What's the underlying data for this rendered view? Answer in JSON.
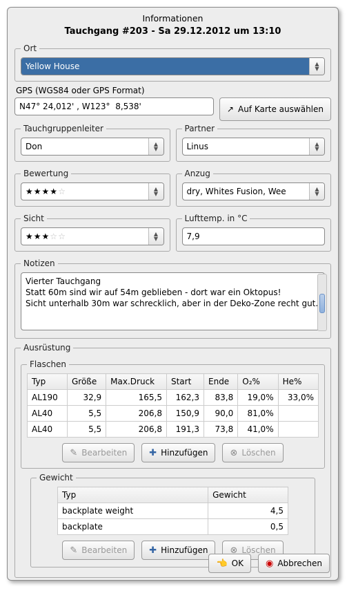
{
  "window": {
    "title": "Informationen",
    "subtitle": "Tauchgang #203 - Sa 29.12.2012 um 13:10"
  },
  "ort": {
    "legend": "Ort",
    "value": "Yellow House"
  },
  "gps": {
    "label": "GPS (WGS84 oder GPS Format)",
    "value": "N47° 24,012' , W123°  8,538'",
    "map_btn": "Auf Karte auswählen"
  },
  "leiter": {
    "legend": "Tauchgruppenleiter",
    "value": "Don"
  },
  "partner": {
    "legend": "Partner",
    "value": "Linus"
  },
  "rating": {
    "legend": "Bewertung",
    "stars": 4,
    "max": 5
  },
  "anzug": {
    "legend": "Anzug",
    "value": "dry, Whites Fusion, Wee"
  },
  "sicht": {
    "legend": "Sicht",
    "stars": 3,
    "max": 5
  },
  "temp": {
    "legend": "Lufttemp. in °C",
    "value": "7,9"
  },
  "notes": {
    "legend": "Notizen",
    "text": "Vierter Tauchgang\nStatt 60m sind wir auf 54m geblieben - dort war ein Oktopus!\nSicht unterhalb 30m war schrecklich, aber in der Deko-Zone recht gut."
  },
  "equip": {
    "legend": "Ausrüstung",
    "cyl_legend": "Flaschen",
    "cyl_headers": [
      "Typ",
      "Größe",
      "Max.Druck",
      "Start",
      "Ende",
      "O₂%",
      "He%"
    ],
    "cyl_rows": [
      [
        "AL190",
        "32,9",
        "165,5",
        "162,3",
        "83,8",
        "19,0%",
        "33,0%"
      ],
      [
        "AL40",
        "5,5",
        "206,8",
        "150,9",
        "90,0",
        "81,0%",
        ""
      ],
      [
        "AL40",
        "5,5",
        "206,8",
        "191,3",
        "73,8",
        "41,0%",
        ""
      ]
    ],
    "wt_legend": "Gewicht",
    "wt_headers": [
      "Typ",
      "Gewicht"
    ],
    "wt_rows": [
      [
        "backplate weight",
        "4,5"
      ],
      [
        "backplate",
        "0,5"
      ]
    ],
    "btn_edit": "Bearbeiten",
    "btn_add": "Hinzufügen",
    "btn_del": "Löschen"
  },
  "footer": {
    "ok": "OK",
    "cancel": "Abbrechen"
  }
}
